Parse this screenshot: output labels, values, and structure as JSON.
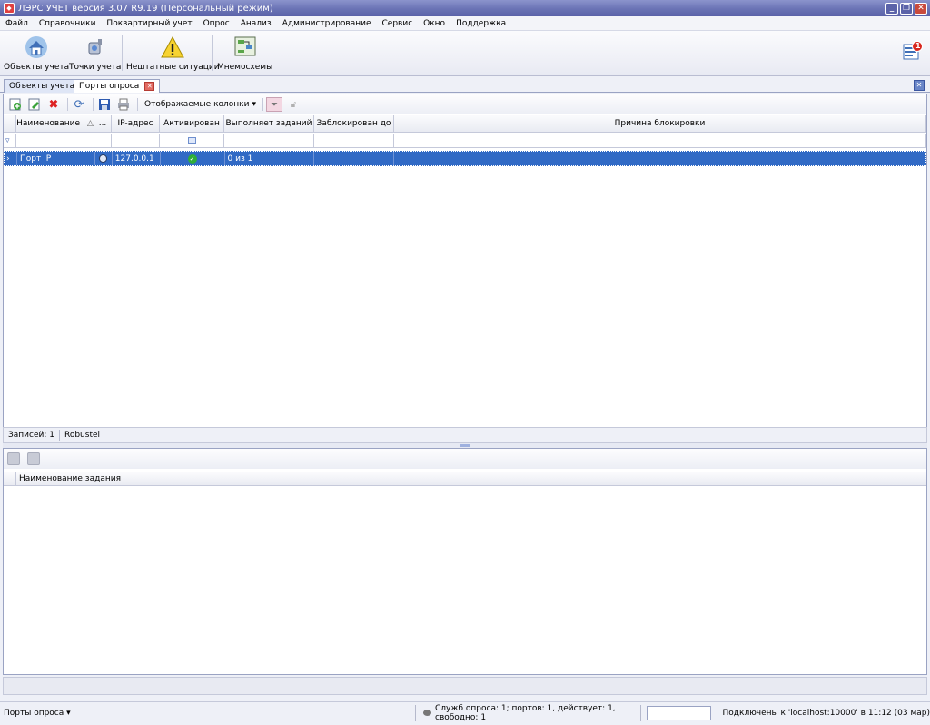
{
  "window": {
    "title": "ЛЭРС УЧЕТ версия 3.07 R9.19 (Персональный режим)"
  },
  "menu": [
    "Файл",
    "Справочники",
    "Поквартирный учет",
    "Опрос",
    "Анализ",
    "Администрирование",
    "Сервис",
    "Окно",
    "Поддержка"
  ],
  "ribbon": {
    "buttons": [
      {
        "label": "Объекты учета",
        "icon": "house-icon"
      },
      {
        "label": "Точки учета",
        "icon": "meter-icon"
      },
      {
        "label": "Нештатные ситуации",
        "icon": "warning-icon"
      },
      {
        "label": "Мнемосхемы",
        "icon": "diagram-icon"
      }
    ],
    "notification_count": "1"
  },
  "tabs": [
    {
      "label": "Объекты учета"
    },
    {
      "label": "Порты опроса"
    }
  ],
  "toolbar": {
    "columns_label": "Отображаемые колонки"
  },
  "grid": {
    "columns": [
      "Наименование",
      "...",
      "IP-адрес",
      "Активирован",
      "Выполняет заданий",
      "Заблокирован до",
      "Причина блокировки"
    ],
    "rows": [
      {
        "name": "Порт IP",
        "ip": "127.0.0.1",
        "activated": true,
        "tasks": "0 из 1",
        "blocked_until": "",
        "reason": ""
      }
    ]
  },
  "status_upper": {
    "records": "Записей: 1",
    "device": "Robustel"
  },
  "lower_grid": {
    "columns": [
      "Наименование задания"
    ]
  },
  "status_bottom": {
    "left": "Порты опроса",
    "service": "Служб опроса: 1; портов: 1, действует: 1, свободно: 1",
    "connection": "Подключены к 'localhost:10000' в 11:12 (03 мар)"
  },
  "colors": {
    "selection": "#316ac5",
    "title": "#6a73b5"
  }
}
